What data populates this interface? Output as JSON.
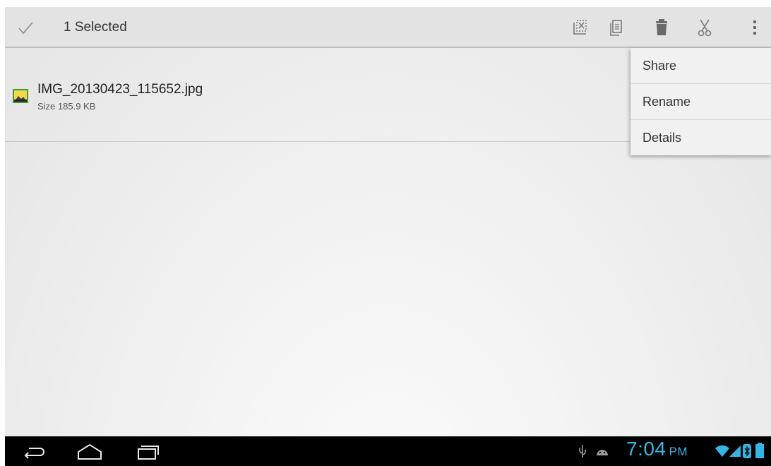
{
  "action_bar": {
    "title": "1 Selected",
    "icons": [
      "done-check-icon",
      "select-none-icon",
      "copy-icon",
      "delete-icon",
      "cut-icon",
      "overflow-menu-icon"
    ]
  },
  "file": {
    "name": "IMG_20130423_115652.jpg",
    "size": "Size 185.9 KB",
    "icon": "image-file-icon"
  },
  "overflow_menu": {
    "items": [
      {
        "label": "Share"
      },
      {
        "label": "Rename"
      },
      {
        "label": "Details"
      }
    ]
  },
  "system_bar": {
    "time": "7:04",
    "ampm": "PM",
    "nav": [
      "back-icon",
      "home-icon",
      "recent-apps-icon"
    ],
    "status": [
      "usb-icon",
      "android-debug-icon",
      "wifi-icon",
      "signal-icon",
      "bluetooth-icon",
      "battery-icon"
    ],
    "accent_color": "#36b4e5"
  }
}
